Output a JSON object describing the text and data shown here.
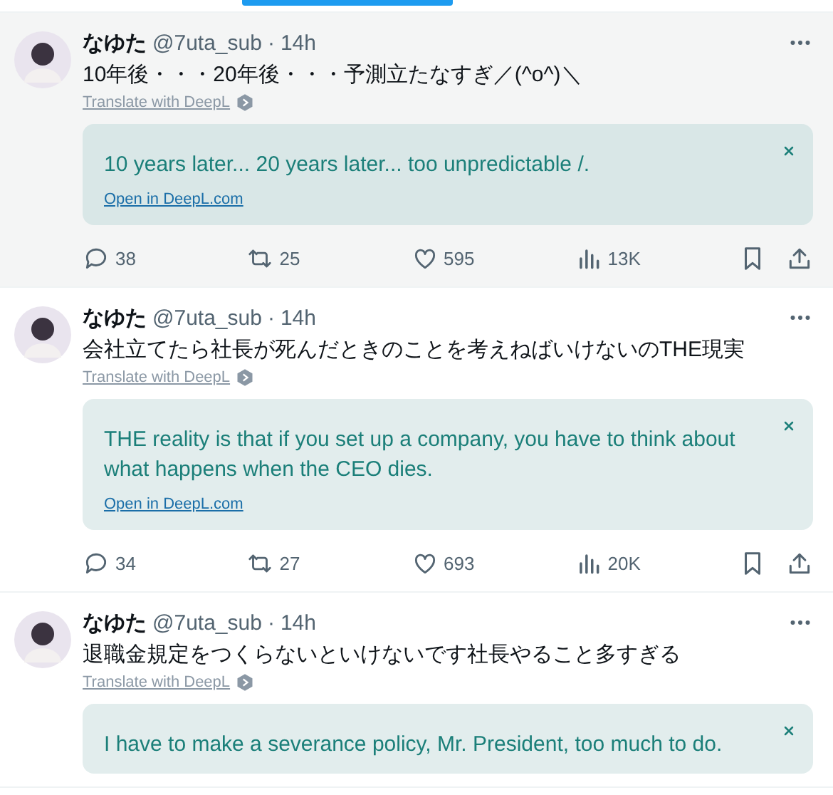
{
  "posts": [
    {
      "author": "なゆた",
      "handle": "@7uta_sub",
      "separator": "·",
      "time": "14h",
      "highlighted": true,
      "text": "10年後・・・20年後・・・予測立たなすぎ／(^o^)＼",
      "translate_label": "Translate with DeepL",
      "translation": {
        "text": "10 years later... 20 years later... too unpredictable /.",
        "link": "Open in DeepL.com"
      },
      "stats": {
        "replies": "38",
        "reposts": "25",
        "likes": "595",
        "views": "13K"
      }
    },
    {
      "author": "なゆた",
      "handle": "@7uta_sub",
      "separator": "·",
      "time": "14h",
      "highlighted": false,
      "text": "会社立てたら社長が死んだときのことを考えねばいけないのTHE現実",
      "translate_label": "Translate with DeepL",
      "translation": {
        "text": "THE reality is that if you set up a company, you have to think about what happens when the CEO dies.",
        "link": "Open in DeepL.com"
      },
      "stats": {
        "replies": "34",
        "reposts": "27",
        "likes": "693",
        "views": "20K"
      }
    },
    {
      "author": "なゆた",
      "handle": "@7uta_sub",
      "separator": "·",
      "time": "14h",
      "highlighted": false,
      "text": "退職金規定をつくらないといけないです社長やること多すぎる",
      "translate_label": "Translate with DeepL",
      "translation": {
        "text": "I have to make a severance policy, Mr. President, too much to do."
      }
    }
  ]
}
